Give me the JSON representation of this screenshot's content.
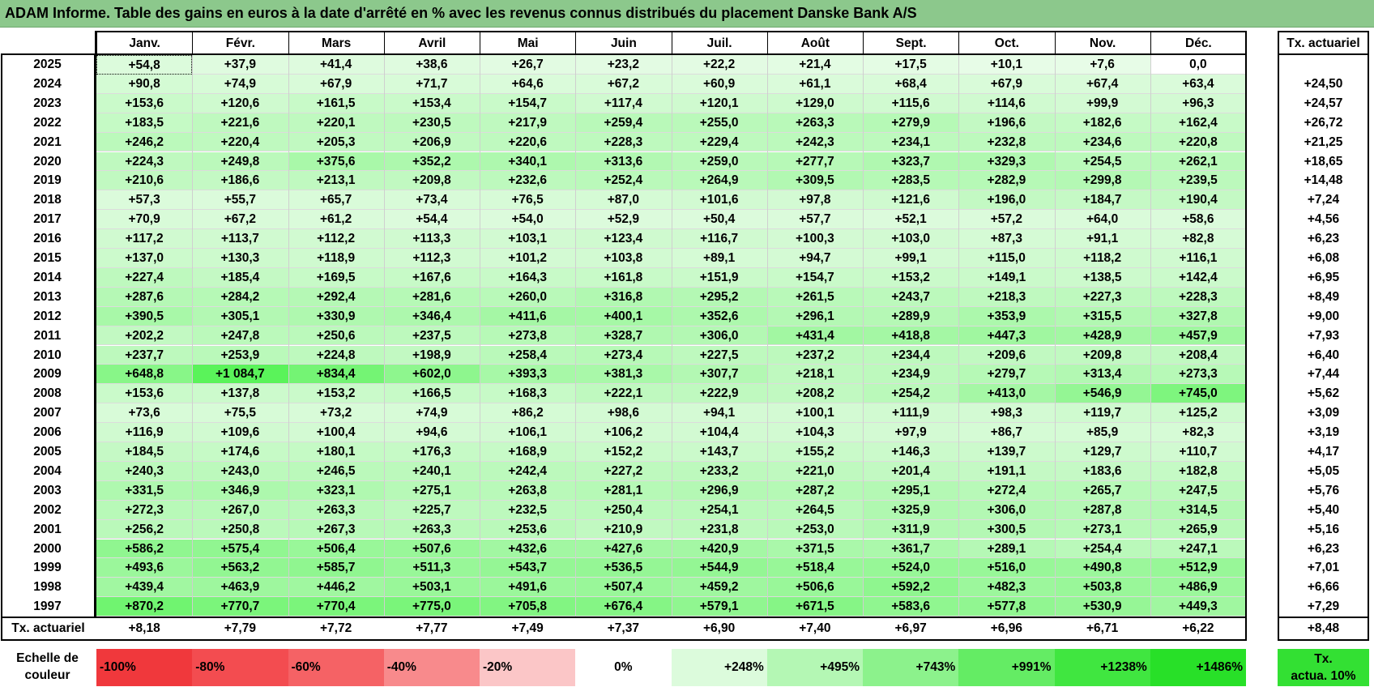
{
  "title": "ADAM Informe. Table des gains en euros à la date d'arrêté en % avec les revenus connus distribués du placement Danske Bank A/S",
  "months": [
    "Janv.",
    "Févr.",
    "Mars",
    "Avril",
    "Mai",
    "Juin",
    "Juil.",
    "Août",
    "Sept.",
    "Oct.",
    "Nov.",
    "Déc."
  ],
  "rate_header": "Tx. actuariel",
  "rows": [
    {
      "year": "2025",
      "values": [
        "+54,8",
        "+37,9",
        "+41,4",
        "+38,6",
        "+26,7",
        "+23,2",
        "+22,2",
        "+21,4",
        "+17,5",
        "+10,1",
        "+7,6",
        "0,0"
      ],
      "rate": ""
    },
    {
      "year": "2024",
      "values": [
        "+90,8",
        "+74,9",
        "+67,9",
        "+71,7",
        "+64,6",
        "+67,2",
        "+60,9",
        "+61,1",
        "+68,4",
        "+67,9",
        "+67,4",
        "+63,4"
      ],
      "rate": "+24,50"
    },
    {
      "year": "2023",
      "values": [
        "+153,6",
        "+120,6",
        "+161,5",
        "+153,4",
        "+154,7",
        "+117,4",
        "+120,1",
        "+129,0",
        "+115,6",
        "+114,6",
        "+99,9",
        "+96,3"
      ],
      "rate": "+24,57"
    },
    {
      "year": "2022",
      "values": [
        "+183,5",
        "+221,6",
        "+220,1",
        "+230,5",
        "+217,9",
        "+259,4",
        "+255,0",
        "+263,3",
        "+279,9",
        "+196,6",
        "+182,6",
        "+162,4"
      ],
      "rate": "+26,72"
    },
    {
      "year": "2021",
      "values": [
        "+246,2",
        "+220,4",
        "+205,3",
        "+206,9",
        "+220,6",
        "+228,3",
        "+229,4",
        "+242,3",
        "+234,1",
        "+232,8",
        "+234,6",
        "+220,8"
      ],
      "rate": "+21,25"
    },
    {
      "year": "2020",
      "values": [
        "+224,3",
        "+249,8",
        "+375,6",
        "+352,2",
        "+340,1",
        "+313,6",
        "+259,0",
        "+277,7",
        "+323,7",
        "+329,3",
        "+254,5",
        "+262,1"
      ],
      "rate": "+18,65"
    },
    {
      "year": "2019",
      "values": [
        "+210,6",
        "+186,6",
        "+213,1",
        "+209,8",
        "+232,6",
        "+252,4",
        "+264,9",
        "+309,5",
        "+283,5",
        "+282,9",
        "+299,8",
        "+239,5"
      ],
      "rate": "+14,48"
    },
    {
      "year": "2018",
      "values": [
        "+57,3",
        "+55,7",
        "+65,7",
        "+73,4",
        "+76,5",
        "+87,0",
        "+101,6",
        "+97,8",
        "+121,6",
        "+196,0",
        "+184,7",
        "+190,4"
      ],
      "rate": "+7,24"
    },
    {
      "year": "2017",
      "values": [
        "+70,9",
        "+67,2",
        "+61,2",
        "+54,4",
        "+54,0",
        "+52,9",
        "+50,4",
        "+57,7",
        "+52,1",
        "+57,2",
        "+64,0",
        "+58,6"
      ],
      "rate": "+4,56"
    },
    {
      "year": "2016",
      "values": [
        "+117,2",
        "+113,7",
        "+112,2",
        "+113,3",
        "+103,1",
        "+123,4",
        "+116,7",
        "+100,3",
        "+103,0",
        "+87,3",
        "+91,1",
        "+82,8"
      ],
      "rate": "+6,23"
    },
    {
      "year": "2015",
      "values": [
        "+137,0",
        "+130,3",
        "+118,9",
        "+112,3",
        "+101,2",
        "+103,8",
        "+89,1",
        "+94,7",
        "+99,1",
        "+115,0",
        "+118,2",
        "+116,1"
      ],
      "rate": "+6,08"
    },
    {
      "year": "2014",
      "values": [
        "+227,4",
        "+185,4",
        "+169,5",
        "+167,6",
        "+164,3",
        "+161,8",
        "+151,9",
        "+154,7",
        "+153,2",
        "+149,1",
        "+138,5",
        "+142,4"
      ],
      "rate": "+6,95"
    },
    {
      "year": "2013",
      "values": [
        "+287,6",
        "+284,2",
        "+292,4",
        "+281,6",
        "+260,0",
        "+316,8",
        "+295,2",
        "+261,5",
        "+243,7",
        "+218,3",
        "+227,3",
        "+228,3"
      ],
      "rate": "+8,49"
    },
    {
      "year": "2012",
      "values": [
        "+390,5",
        "+305,1",
        "+330,9",
        "+346,4",
        "+411,6",
        "+400,1",
        "+352,6",
        "+296,1",
        "+289,9",
        "+353,9",
        "+315,5",
        "+327,8"
      ],
      "rate": "+9,00"
    },
    {
      "year": "2011",
      "values": [
        "+202,2",
        "+247,8",
        "+250,6",
        "+237,5",
        "+273,8",
        "+328,7",
        "+306,0",
        "+431,4",
        "+418,8",
        "+447,3",
        "+428,9",
        "+457,9"
      ],
      "rate": "+7,93"
    },
    {
      "year": "2010",
      "values": [
        "+237,7",
        "+253,9",
        "+224,8",
        "+198,9",
        "+258,4",
        "+273,4",
        "+227,5",
        "+237,2",
        "+234,4",
        "+209,6",
        "+209,8",
        "+208,4"
      ],
      "rate": "+6,40"
    },
    {
      "year": "2009",
      "values": [
        "+648,8",
        "+1 084,7",
        "+834,4",
        "+602,0",
        "+393,3",
        "+381,3",
        "+307,7",
        "+218,1",
        "+234,9",
        "+279,7",
        "+313,4",
        "+273,3"
      ],
      "rate": "+7,44"
    },
    {
      "year": "2008",
      "values": [
        "+153,6",
        "+137,8",
        "+153,2",
        "+166,5",
        "+168,3",
        "+222,1",
        "+222,9",
        "+208,2",
        "+254,2",
        "+413,0",
        "+546,9",
        "+745,0"
      ],
      "rate": "+5,62"
    },
    {
      "year": "2007",
      "values": [
        "+73,6",
        "+75,5",
        "+73,2",
        "+74,9",
        "+86,2",
        "+98,6",
        "+94,1",
        "+100,1",
        "+111,9",
        "+98,3",
        "+119,7",
        "+125,2"
      ],
      "rate": "+3,09"
    },
    {
      "year": "2006",
      "values": [
        "+116,9",
        "+109,6",
        "+100,4",
        "+94,6",
        "+106,1",
        "+106,2",
        "+104,4",
        "+104,3",
        "+97,9",
        "+86,7",
        "+85,9",
        "+82,3"
      ],
      "rate": "+3,19"
    },
    {
      "year": "2005",
      "values": [
        "+184,5",
        "+174,6",
        "+180,1",
        "+176,3",
        "+168,9",
        "+152,2",
        "+143,7",
        "+155,2",
        "+146,3",
        "+139,7",
        "+129,7",
        "+110,7"
      ],
      "rate": "+4,17"
    },
    {
      "year": "2004",
      "values": [
        "+240,3",
        "+243,0",
        "+246,5",
        "+240,1",
        "+242,4",
        "+227,2",
        "+233,2",
        "+221,0",
        "+201,4",
        "+191,1",
        "+183,6",
        "+182,8"
      ],
      "rate": "+5,05"
    },
    {
      "year": "2003",
      "values": [
        "+331,5",
        "+346,9",
        "+323,1",
        "+275,1",
        "+263,8",
        "+281,1",
        "+296,9",
        "+287,2",
        "+295,1",
        "+272,4",
        "+265,7",
        "+247,5"
      ],
      "rate": "+5,76"
    },
    {
      "year": "2002",
      "values": [
        "+272,3",
        "+267,0",
        "+263,3",
        "+225,7",
        "+232,5",
        "+250,4",
        "+254,1",
        "+264,5",
        "+325,9",
        "+306,0",
        "+287,8",
        "+314,5"
      ],
      "rate": "+5,40"
    },
    {
      "year": "2001",
      "values": [
        "+256,2",
        "+250,8",
        "+267,3",
        "+263,3",
        "+253,6",
        "+210,9",
        "+231,8",
        "+253,0",
        "+311,9",
        "+300,5",
        "+273,1",
        "+265,9"
      ],
      "rate": "+5,16"
    },
    {
      "year": "2000",
      "values": [
        "+586,2",
        "+575,4",
        "+506,4",
        "+507,6",
        "+432,6",
        "+427,6",
        "+420,9",
        "+371,5",
        "+361,7",
        "+289,1",
        "+254,4",
        "+247,1"
      ],
      "rate": "+6,23"
    },
    {
      "year": "1999",
      "values": [
        "+493,6",
        "+563,2",
        "+585,7",
        "+511,3",
        "+543,7",
        "+536,5",
        "+544,9",
        "+518,4",
        "+524,0",
        "+516,0",
        "+490,8",
        "+512,9"
      ],
      "rate": "+7,01"
    },
    {
      "year": "1998",
      "values": [
        "+439,4",
        "+463,9",
        "+446,2",
        "+503,1",
        "+491,6",
        "+507,4",
        "+459,2",
        "+506,6",
        "+592,2",
        "+482,3",
        "+503,8",
        "+486,9"
      ],
      "rate": "+6,66"
    },
    {
      "year": "1997",
      "values": [
        "+870,2",
        "+770,7",
        "+770,4",
        "+775,0",
        "+705,8",
        "+676,4",
        "+579,1",
        "+671,5",
        "+583,6",
        "+577,8",
        "+530,9",
        "+449,3"
      ],
      "rate": "+7,29"
    }
  ],
  "footer": {
    "label": "Tx. actuariel",
    "values": [
      "+8,18",
      "+7,79",
      "+7,72",
      "+7,77",
      "+7,49",
      "+7,37",
      "+6,90",
      "+7,40",
      "+6,97",
      "+6,96",
      "+6,71",
      "+6,22"
    ],
    "overall": "+8,48"
  },
  "scale": {
    "label_line1": "Echelle de",
    "label_line2": "couleur",
    "items": [
      {
        "label": "-100%",
        "color": "#f0383c"
      },
      {
        "label": "-80%",
        "color": "#f34c50"
      },
      {
        "label": "-60%",
        "color": "#f56265"
      },
      {
        "label": "-40%",
        "color": "#f88a8c"
      },
      {
        "label": "-20%",
        "color": "#fbc6c7"
      },
      {
        "label": "0%",
        "color": "#ffffff"
      },
      {
        "label": "+248%",
        "color": "#dcfbdc"
      },
      {
        "label": "+495%",
        "color": "#b4f7b4"
      },
      {
        "label": "+743%",
        "color": "#8cf28c"
      },
      {
        "label": "+991%",
        "color": "#64ec64"
      },
      {
        "label": "+1238%",
        "color": "#40e640"
      },
      {
        "label": "+1486%",
        "color": "#28e028"
      }
    ],
    "legend_line1": "Tx.",
    "legend_line2": "actua. 10%",
    "legend_color": "#33e033"
  }
}
